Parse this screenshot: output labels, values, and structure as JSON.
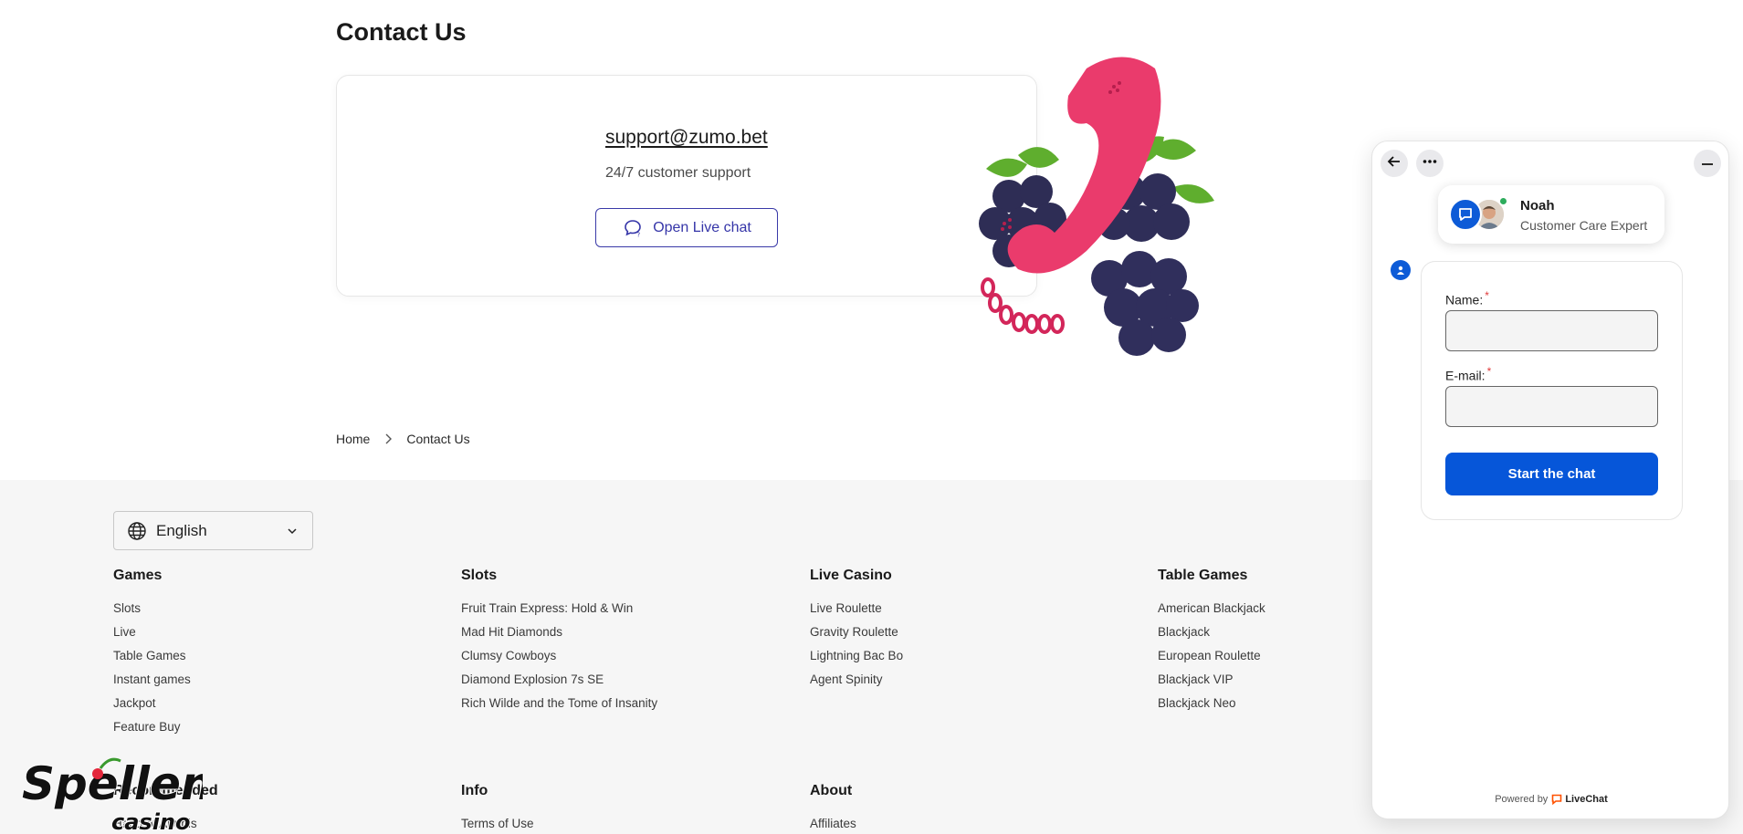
{
  "page": {
    "title": "Contact Us",
    "support_email": "support@zumo.bet",
    "support_sub": "24/7 customer support",
    "live_chat_label": "Open Live chat"
  },
  "breadcrumb": {
    "home": "Home",
    "current": "Contact Us"
  },
  "footer": {
    "language": "English",
    "columns": [
      {
        "heading": "Games",
        "items": [
          "Slots",
          "Live",
          "Table Games",
          "Instant games",
          "Jackpot",
          "Feature Buy"
        ]
      },
      {
        "heading": "Slots",
        "items": [
          "Fruit Train Express: Hold & Win",
          "Mad Hit Diamonds",
          "Clumsy Cowboys",
          "Diamond Explosion 7s SE",
          "Rich Wilde and the Tome of Insanity"
        ]
      },
      {
        "heading": "Live Casino",
        "items": [
          "Live Roulette",
          "Gravity Roulette",
          "Lightning Bac Bo",
          "Agent Spinity"
        ]
      },
      {
        "heading": "Table Games",
        "items": [
          "American Blackjack",
          "Blackjack",
          "European Roulette",
          "Blackjack VIP",
          "Blackjack Neo"
        ]
      }
    ],
    "bottom_columns": [
      {
        "heading": "Recommended",
        "items": [
          "Hand of Anubis"
        ]
      },
      {
        "heading": "Info",
        "items": [
          "Terms of Use"
        ]
      },
      {
        "heading": "About",
        "items": [
          "Affiliates"
        ]
      }
    ]
  },
  "watermark": {
    "line1": "Spellen",
    "line2": "casino"
  },
  "chat": {
    "agent_name": "Noah",
    "agent_role": "Customer Care Expert",
    "name_label": "Name:",
    "email_label": "E-mail:",
    "required_mark": "*",
    "name_value": "",
    "email_value": "",
    "start_label": "Start the chat",
    "powered_by": "Powered by",
    "brand": "LiveChat"
  },
  "colors": {
    "accent": "#0656d9",
    "link_button": "#3535a8",
    "footer_bg": "#f6f6f6",
    "phone": "#ea3b6c",
    "berries": "#2e2d55"
  }
}
